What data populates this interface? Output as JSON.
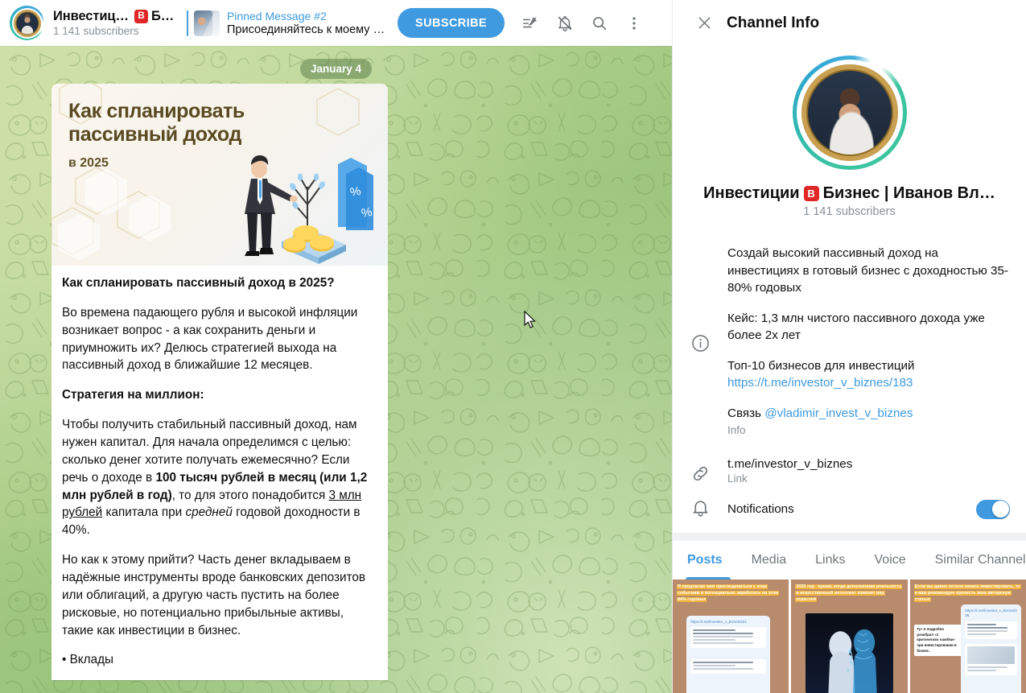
{
  "header": {
    "channel_title": "Инвестиции",
    "channel_title_tail": "Б…",
    "verified_badge": "B",
    "subscribers": "1 141 subscribers",
    "pinned_label": "Pinned Message #2",
    "pinned_preview": "Присоединяйтесь к моему к…",
    "subscribe_label": "SUBSCRIBE",
    "icons": [
      "pinned-messages-icon",
      "mute-bell-icon",
      "search-icon",
      "more-options-icon"
    ]
  },
  "chat": {
    "date_divider": "January 4",
    "post_image": {
      "title_line1": "Как спланировать",
      "title_line2": "пассивный доход",
      "year": "в 2025"
    },
    "paragraphs": [
      {
        "html": "<b>Как спланировать пассивный доход в 2025?</b>"
      },
      {
        "html": "Во времена падающего рубля и высокой инфляции возникает вопрос - а как сохранить деньги и приумножить их? Делюсь стратегией выхода на пассивный доход в ближайшие 12 месяцев."
      },
      {
        "html": "<b>Стратегия на миллион:</b>"
      },
      {
        "html": "Чтобы получить стабильный пассивный доход, нам нужен капитал. Для начала определимся с целью: сколько денег хотите получать ежемесячно? Если речь о доходе в <b>100 тысяч рублей в месяц (или 1,2 млн рублей в год)</b>, то для этого понадобится <u>3 млн рублей</u> капитала при <i>средней</i> годовой доходности в 40%."
      },
      {
        "html": "Но как к этому прийти? Часть денег вкладываем в надёжные инструменты вроде банковских депозитов или облигаций, а другую часть пустить на более рисковые, но потенциально прибыльные активы, такие как инвестиции в бизнес."
      },
      {
        "html": "• Вклады"
      }
    ]
  },
  "info_panel": {
    "title": "Channel Info",
    "close_icon": "close-icon",
    "channel_name": "Инвестиции",
    "channel_name_tail": "Бизнес | Иванов Вл…",
    "verified_badge": "B",
    "subscribers": "1 141 subscribers",
    "about": {
      "icon": "info-icon",
      "p1": "Создай высокий пассивный доход на инвестициях в готовый бизнес с доходностью 35-80% годовых",
      "p2": "Кейс: 1,3 млн чистого пассивного дохода уже более 2х лет",
      "p3_text": "Топ-10 бизнесов для инвестиций",
      "p3_link": "https://t.me/investor_v_biznes/183",
      "p4_text": "Связь ",
      "p4_link": "@vladimir_invest_v_biznes",
      "label": "Info"
    },
    "link": {
      "icon": "link-icon",
      "value": "t.me/investor_v_biznes",
      "label": "Link"
    },
    "notifications": {
      "icon": "bell-icon",
      "label": "Notifications",
      "enabled": true,
      "accent": "#3f9ae0"
    },
    "tabs": [
      {
        "label": "Posts",
        "active": true
      },
      {
        "label": "Media",
        "active": false
      },
      {
        "label": "Links",
        "active": false
      },
      {
        "label": "Voice",
        "active": false
      },
      {
        "label": "Similar Channel",
        "active": false
      }
    ],
    "media_items": [
      {
        "caption": "Я предлагаю вам присоединиться к этим событиям и потенциально заработать на этом 84% годовых",
        "link": "https://t.me/investor_v_biznes/241",
        "kind": "post-screenshot"
      },
      {
        "caption": "2025 год - время, когда дополненная реальность и искусственный интеллект изменят ряд отраслей",
        "kind": "ai-photo"
      },
      {
        "caption": "Если вы давно хотели начать инвестировать, то я вам рекомендую прочесть мою авторскую статью",
        "link": "https://t.me/investor_v_biznes/236",
        "note": "Тут я подробно разобрал «3 критических ошибки» при инвестировании в бизнес.",
        "kind": "post-screenshot"
      }
    ]
  },
  "colors": {
    "accent": "#3f9ae0",
    "chat_bg_green": "#9fc77f",
    "badge_red": "#e02727",
    "muted_text": "#8a9096"
  }
}
